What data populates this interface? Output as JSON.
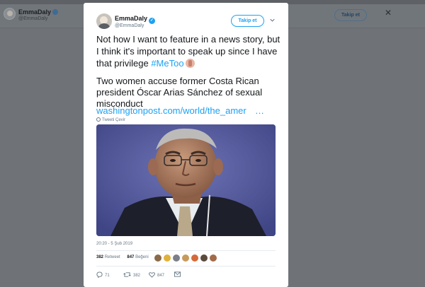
{
  "background": {
    "profile_name": "EmmaDaly",
    "profile_handle": "@EmmaDaly",
    "follow_label": "Takip et",
    "close_glyph": "✕"
  },
  "tweet": {
    "author_name": "EmmaDaly",
    "author_handle": "@EmmaDaly",
    "follow_label": "Takip et",
    "text_part1": "Not how I want to feature in a news story, but I think it's important to speak up since I have that privilege ",
    "hashtag": "#MeToo",
    "paragraph2": "Two women accuse former Costa Rican president Óscar Arias Sánchez of sexual misconduct",
    "link_text": "washingtonpost.com/world/the_amer",
    "link_ellipsis": "…",
    "translate_label": "Tweeti Çevir",
    "timestamp": "20:20 - 5 Şub 2019",
    "retweet_count": "382",
    "retweet_label": "Retweet",
    "like_count": "847",
    "like_label": "Beğeni",
    "reply_count": "71",
    "action_retweet_count": "382",
    "action_like_count": "847"
  },
  "icons": {
    "verified": "verified-badge-icon",
    "chevron": "chevron-down-icon",
    "globe": "globe-icon",
    "reply": "reply-icon",
    "retweet": "retweet-icon",
    "like": "heart-icon",
    "dm": "envelope-icon"
  },
  "colors": {
    "accent": "#1da1f2",
    "text": "#14171a",
    "muted": "#657786",
    "overlay": "#6f7378"
  }
}
